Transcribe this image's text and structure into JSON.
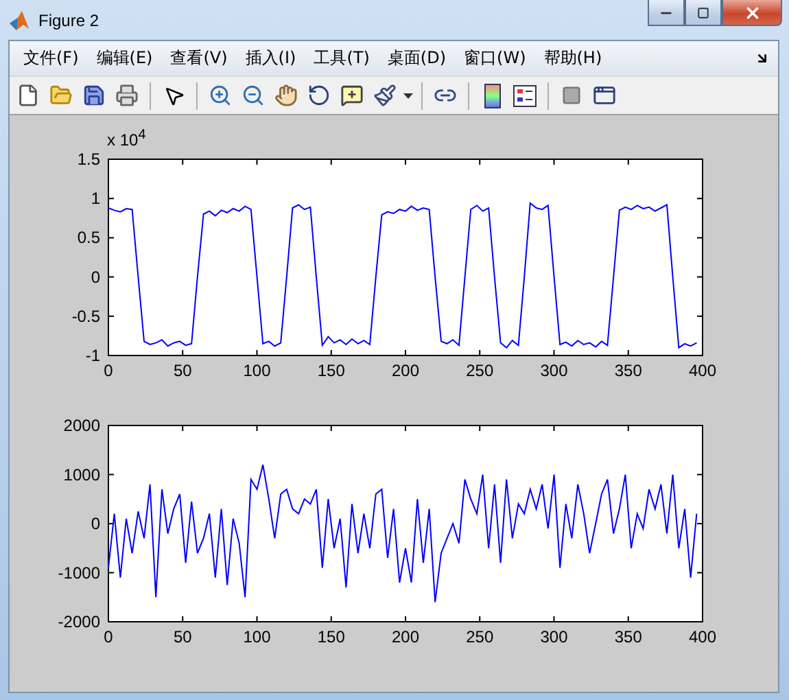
{
  "window": {
    "title": "Figure 2"
  },
  "menu": [
    {
      "label": "文件(F)"
    },
    {
      "label": "编辑(E)"
    },
    {
      "label": "查看(V)"
    },
    {
      "label": "插入(I)"
    },
    {
      "label": "工具(T)"
    },
    {
      "label": "桌面(D)"
    },
    {
      "label": "窗口(W)"
    },
    {
      "label": "帮助(H)"
    }
  ],
  "axes": [
    {
      "exponent": "x 10$^{4}$",
      "chart_data": {
        "type": "line",
        "xlim": [
          0,
          400
        ],
        "ylim": [
          -1,
          1.5
        ],
        "xticks": [
          0,
          50,
          100,
          150,
          200,
          250,
          300,
          350,
          400
        ],
        "yticks": [
          -1,
          -0.5,
          0,
          0.5,
          1,
          1.5
        ],
        "x": [
          0,
          4,
          8,
          12,
          16,
          20,
          24,
          28,
          32,
          36,
          40,
          44,
          48,
          52,
          56,
          60,
          64,
          68,
          72,
          76,
          80,
          84,
          88,
          92,
          96,
          100,
          104,
          108,
          112,
          116,
          120,
          124,
          128,
          132,
          136,
          140,
          144,
          148,
          152,
          156,
          160,
          164,
          168,
          172,
          176,
          180,
          184,
          188,
          192,
          196,
          200,
          204,
          208,
          212,
          216,
          220,
          224,
          228,
          232,
          236,
          240,
          244,
          248,
          252,
          256,
          260,
          264,
          268,
          272,
          276,
          280,
          284,
          288,
          292,
          296,
          300,
          304,
          308,
          312,
          316,
          320,
          324,
          328,
          332,
          336,
          340,
          344,
          348,
          352,
          356,
          360,
          364,
          368,
          372,
          376,
          380,
          384,
          388,
          392,
          396
        ],
        "series": [
          {
            "color": "#0000ff",
            "values": [
              0.88,
              0.85,
              0.83,
              0.87,
              0.86,
              0,
              -0.82,
              -0.86,
              -0.84,
              -0.8,
              -0.88,
              -0.84,
              -0.82,
              -0.87,
              -0.85,
              0,
              0.8,
              0.84,
              0.78,
              0.85,
              0.82,
              0.87,
              0.84,
              0.9,
              0.86,
              0,
              -0.85,
              -0.82,
              -0.88,
              -0.84,
              0,
              0.88,
              0.92,
              0.86,
              0.89,
              0,
              -0.87,
              -0.76,
              -0.84,
              -0.8,
              -0.86,
              -0.79,
              -0.85,
              -0.81,
              -0.86,
              0,
              0.79,
              0.83,
              0.81,
              0.86,
              0.84,
              0.9,
              0.85,
              0.88,
              0.86,
              0,
              -0.82,
              -0.85,
              -0.8,
              -0.87,
              0,
              0.86,
              0.91,
              0.84,
              0.88,
              0,
              -0.84,
              -0.9,
              -0.81,
              -0.87,
              0,
              0.94,
              0.88,
              0.86,
              0.91,
              0,
              -0.86,
              -0.83,
              -0.88,
              -0.81,
              -0.86,
              -0.84,
              -0.89,
              -0.82,
              -0.87,
              0,
              0.85,
              0.89,
              0.86,
              0.91,
              0.87,
              0.89,
              0.84,
              0.88,
              0.92,
              0,
              -0.9,
              -0.85,
              -0.88,
              -0.84
            ]
          }
        ]
      }
    },
    {
      "chart_data": {
        "type": "line",
        "xlim": [
          0,
          400
        ],
        "ylim": [
          -2000,
          2000
        ],
        "xticks": [
          0,
          50,
          100,
          150,
          200,
          250,
          300,
          350,
          400
        ],
        "yticks": [
          -2000,
          -1000,
          0,
          1000,
          2000
        ],
        "x": [
          0,
          4,
          8,
          12,
          16,
          20,
          24,
          28,
          32,
          36,
          40,
          44,
          48,
          52,
          56,
          60,
          64,
          68,
          72,
          76,
          80,
          84,
          88,
          92,
          96,
          100,
          104,
          108,
          112,
          116,
          120,
          124,
          128,
          132,
          136,
          140,
          144,
          148,
          152,
          156,
          160,
          164,
          168,
          172,
          176,
          180,
          184,
          188,
          192,
          196,
          200,
          204,
          208,
          212,
          216,
          220,
          224,
          228,
          232,
          236,
          240,
          244,
          248,
          252,
          256,
          260,
          264,
          268,
          272,
          276,
          280,
          284,
          288,
          292,
          296,
          300,
          304,
          308,
          312,
          316,
          320,
          324,
          328,
          332,
          336,
          340,
          344,
          348,
          352,
          356,
          360,
          364,
          368,
          372,
          376,
          380,
          384,
          388,
          392,
          396
        ],
        "series": [
          {
            "color": "#0000ff",
            "values": [
              -900,
              200,
              -1100,
              100,
              -600,
              250,
              -300,
              800,
              -1500,
              700,
              -200,
              300,
              600,
              -800,
              450,
              -600,
              -300,
              200,
              -1100,
              300,
              -1250,
              100,
              -400,
              -1500,
              900,
              700,
              1200,
              500,
              -300,
              600,
              700,
              300,
              200,
              500,
              400,
              700,
              -900,
              500,
              -500,
              100,
              -1300,
              400,
              -600,
              200,
              -500,
              600,
              700,
              -700,
              300,
              -1200,
              -500,
              -1200,
              500,
              -800,
              300,
              -1600,
              -600,
              -300,
              0,
              -400,
              900,
              500,
              200,
              1000,
              -500,
              800,
              -800,
              900,
              -300,
              400,
              200,
              700,
              300,
              800,
              -100,
              1000,
              -900,
              400,
              -300,
              800,
              200,
              -600,
              0,
              600,
              900,
              -200,
              300,
              1000,
              -500,
              200,
              -100,
              700,
              300,
              800,
              -200,
              1000,
              -500,
              300,
              -1100,
              200
            ]
          }
        ]
      }
    }
  ]
}
